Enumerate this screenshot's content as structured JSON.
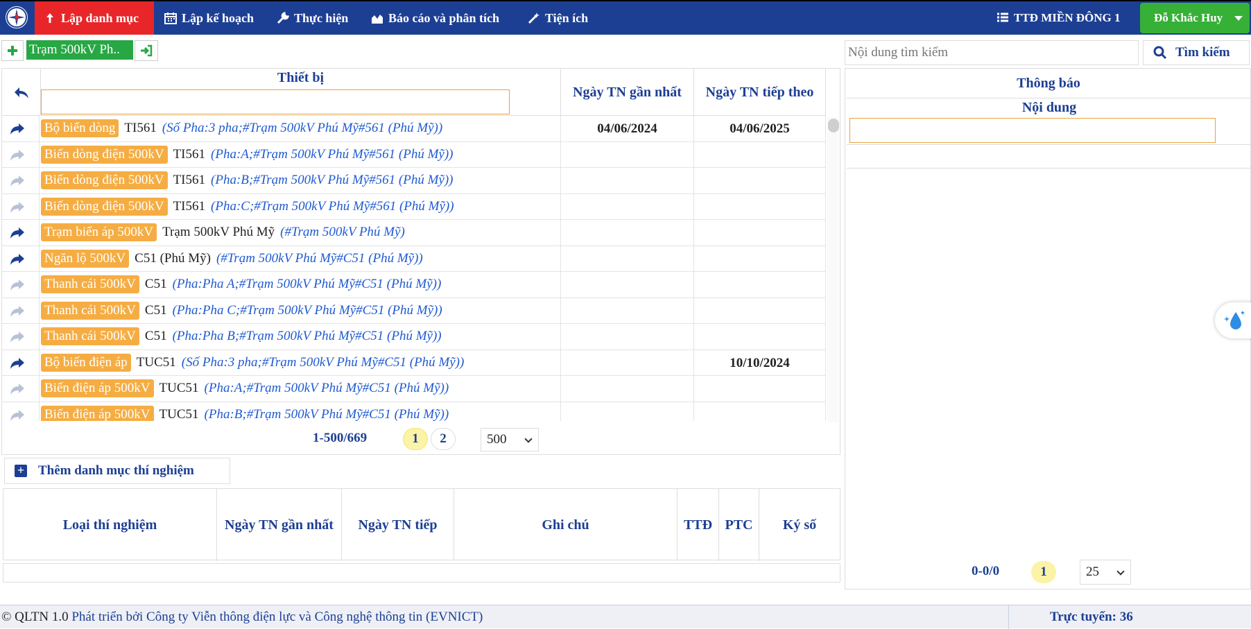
{
  "nav": {
    "items": [
      {
        "label": "Lập danh mục",
        "icon": "upload-arrow-icon"
      },
      {
        "label": "Lập kế hoạch",
        "icon": "calendar-icon"
      },
      {
        "label": "Thực hiện",
        "icon": "wrench-icon"
      },
      {
        "label": "Báo cáo và phân tích",
        "icon": "area-chart-icon"
      },
      {
        "label": "Tiện ích",
        "icon": "magic-wand-icon"
      }
    ],
    "unit": "TTĐ MIỀN ĐÔNG 1",
    "user": "Đỗ Khắc Huy"
  },
  "toolbar": {
    "station": "Trạm 500kV Ph..",
    "search_placeholder": "Nội dung tìm kiếm",
    "search_button": "Tìm kiếm"
  },
  "device_table": {
    "col_device": "Thiết bị",
    "col_last": "Ngày TN gần nhất",
    "col_next": "Ngày TN tiếp theo",
    "rows": [
      {
        "tag": "Bộ biến dòng",
        "code": "TI561",
        "desc": "(Số Pha:3 pha;#Trạm 500kV Phú Mỹ#561 (Phú Mỹ))",
        "last": "04/06/2024",
        "next": "04/06/2025",
        "arrow": "dark"
      },
      {
        "tag": "Biến dòng điện 500kV",
        "code": "TI561",
        "desc": "(Pha:A;#Trạm 500kV Phú Mỹ#561 (Phú Mỹ))",
        "last": "",
        "next": "",
        "arrow": "light"
      },
      {
        "tag": "Biến dòng điện 500kV",
        "code": "TI561",
        "desc": "(Pha:B;#Trạm 500kV Phú Mỹ#561 (Phú Mỹ))",
        "last": "",
        "next": "",
        "arrow": "light"
      },
      {
        "tag": "Biến dòng điện 500kV",
        "code": "TI561",
        "desc": "(Pha:C;#Trạm 500kV Phú Mỹ#561 (Phú Mỹ))",
        "last": "",
        "next": "",
        "arrow": "light"
      },
      {
        "tag": "Trạm biến áp 500kV",
        "code": "Trạm 500kV Phú Mỹ",
        "desc": "(#Trạm 500kV Phú Mỹ)",
        "last": "",
        "next": "",
        "arrow": "dark"
      },
      {
        "tag": "Ngăn lộ 500kV",
        "code": "C51 (Phú Mỹ)",
        "desc": "(#Trạm 500kV Phú Mỹ#C51 (Phú Mỹ))",
        "last": "",
        "next": "",
        "arrow": "dark"
      },
      {
        "tag": "Thanh cái 500kV",
        "code": "C51",
        "desc": "(Pha:Pha A;#Trạm 500kV Phú Mỹ#C51 (Phú Mỹ))",
        "last": "",
        "next": "",
        "arrow": "light"
      },
      {
        "tag": "Thanh cái 500kV",
        "code": "C51",
        "desc": "(Pha:Pha C;#Trạm 500kV Phú Mỹ#C51 (Phú Mỹ))",
        "last": "",
        "next": "",
        "arrow": "light"
      },
      {
        "tag": "Thanh cái 500kV",
        "code": "C51",
        "desc": "(Pha:Pha B;#Trạm 500kV Phú Mỹ#C51 (Phú Mỹ))",
        "last": "",
        "next": "",
        "arrow": "light"
      },
      {
        "tag": "Bộ biến điện áp",
        "code": "TUC51",
        "desc": "(Số Pha:3 pha;#Trạm 500kV Phú Mỹ#C51 (Phú Mỹ))",
        "last": "",
        "next": "10/10/2024",
        "arrow": "dark"
      },
      {
        "tag": "Biến điện áp 500kV",
        "code": "TUC51",
        "desc": "(Pha:A;#Trạm 500kV Phú Mỹ#C51 (Phú Mỹ))",
        "last": "",
        "next": "",
        "arrow": "light"
      },
      {
        "tag": "Biến điện áp 500kV",
        "code": "TUC51",
        "desc": "(Pha:B;#Trạm 500kV Phú Mỹ#C51 (Phú Mỹ))",
        "last": "",
        "next": "",
        "arrow": "light"
      }
    ],
    "pager_text": "1-500/669",
    "pages": [
      "1",
      "2"
    ],
    "page_size": "500"
  },
  "add_category": "Thêm danh mục thí nghiệm",
  "test_table": {
    "cols": [
      "Loại thí nghiệm",
      "Ngày TN gần nhất",
      "Ngày TN tiếp",
      "Ghi chú",
      "TTĐ",
      "PTC",
      "Ký số"
    ]
  },
  "notice": {
    "title": "Thông báo",
    "col": "Nội dung",
    "pager_text": "0-0/0",
    "page": "1",
    "page_size": "25"
  },
  "footer": {
    "copyright": "© QLTN 1.0",
    "developer": "Phát triển bởi Công ty Viễn thông điện lực và Công nghệ thông tin (EVNICT)",
    "online": "Trực tuyến: 36"
  },
  "colors": {
    "nav_bg": "#1d3f93",
    "active_red": "#e8262a",
    "user_green": "#36b036",
    "tag_orange": "#f5ad43",
    "desc_blue": "#1f5ad1"
  }
}
